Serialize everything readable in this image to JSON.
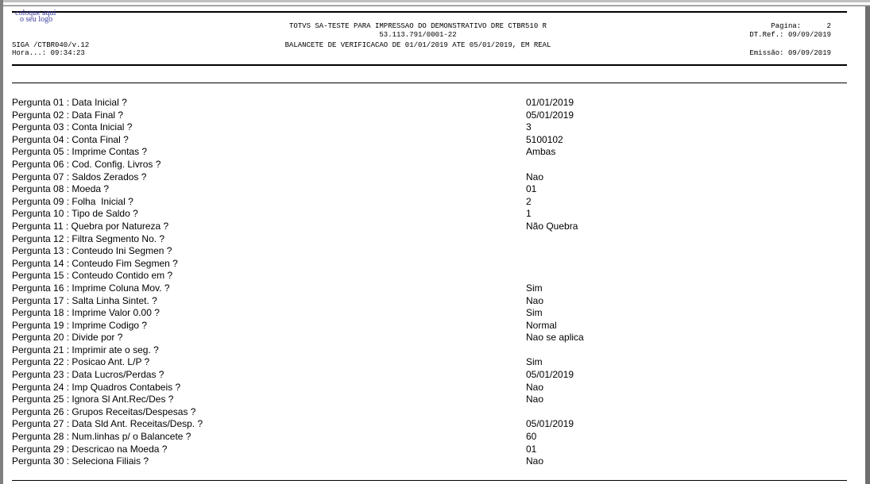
{
  "logo": {
    "line1": "coloque aqui",
    "line2": "o seu logo"
  },
  "header": {
    "company_line": "TOTVS SA-TESTE PARA IMPRESSAO DO DEMONSTRATIVO DRE CTBR510 R",
    "cnpj": "53.113.791/0001-22",
    "report_title": "BALANCETE DE VERIFICACAO DE 01/01/2019 ATE 05/01/2019, EM REAL",
    "program": "SIGA /CTBR040/v.12",
    "time": "Hora...: 09:34:23",
    "page_label": "Pagina:      2",
    "ref_date": "DT.Ref.: 09/09/2019",
    "emission": "Emissão: 09/09/2019"
  },
  "questions": [
    {
      "label": "Pergunta 01 : Data Inicial ?",
      "value": "01/01/2019"
    },
    {
      "label": "Pergunta 02 : Data Final ?",
      "value": "05/01/2019"
    },
    {
      "label": "Pergunta 03 : Conta Inicial ?",
      "value": "3"
    },
    {
      "label": "Pergunta 04 : Conta Final ?",
      "value": "5100102"
    },
    {
      "label": "Pergunta 05 : Imprime Contas ?",
      "value": "Ambas"
    },
    {
      "label": "Pergunta 06 : Cod. Config. Livros ?",
      "value": ""
    },
    {
      "label": "Pergunta 07 : Saldos Zerados ?",
      "value": "Nao"
    },
    {
      "label": "Pergunta 08 : Moeda ?",
      "value": "01"
    },
    {
      "label": "Pergunta 09 : Folha  Inicial ?",
      "value": "2"
    },
    {
      "label": "Pergunta 10 : Tipo de Saldo ?",
      "value": "1"
    },
    {
      "label": "Pergunta 11 : Quebra por Natureza ?",
      "value": "Não Quebra"
    },
    {
      "label": "Pergunta 12 : Filtra Segmento No. ?",
      "value": ""
    },
    {
      "label": "Pergunta 13 : Conteudo Ini Segmen ?",
      "value": ""
    },
    {
      "label": "Pergunta 14 : Conteudo Fim Segmen ?",
      "value": ""
    },
    {
      "label": "Pergunta 15 : Conteudo Contido em ?",
      "value": ""
    },
    {
      "label": "Pergunta 16 : Imprime Coluna Mov. ?",
      "value": "Sim"
    },
    {
      "label": "Pergunta 17 : Salta Linha Sintet. ?",
      "value": "Nao"
    },
    {
      "label": "Pergunta 18 : Imprime Valor 0.00 ?",
      "value": "Sim"
    },
    {
      "label": "Pergunta 19 : Imprime Codigo ?",
      "value": "Normal"
    },
    {
      "label": "Pergunta 20 : Divide por ?",
      "value": "Nao se aplica"
    },
    {
      "label": "Pergunta 21 : Imprimir ate o seg. ?",
      "value": ""
    },
    {
      "label": "Pergunta 22 : Posicao Ant. L/P ?",
      "value": "Sim"
    },
    {
      "label": "Pergunta 23 : Data Lucros/Perdas ?",
      "value": "05/01/2019"
    },
    {
      "label": "Pergunta 24 : Imp Quadros Contabeis ?",
      "value": "Nao"
    },
    {
      "label": "Pergunta 25 : Ignora Sl Ant.Rec/Des ?",
      "value": "Nao"
    },
    {
      "label": "Pergunta 26 : Grupos Receitas/Despesas ?",
      "value": ""
    },
    {
      "label": "Pergunta 27 : Data Sld Ant. Receitas/Desp. ?",
      "value": "05/01/2019"
    },
    {
      "label": "Pergunta 28 : Num.linhas p/ o Balancete ?",
      "value": "60"
    },
    {
      "label": "Pergunta 29 : Descricao na Moeda ?",
      "value": "01"
    },
    {
      "label": "Pergunta 30 : Seleciona Filiais ?",
      "value": "Nao"
    }
  ]
}
